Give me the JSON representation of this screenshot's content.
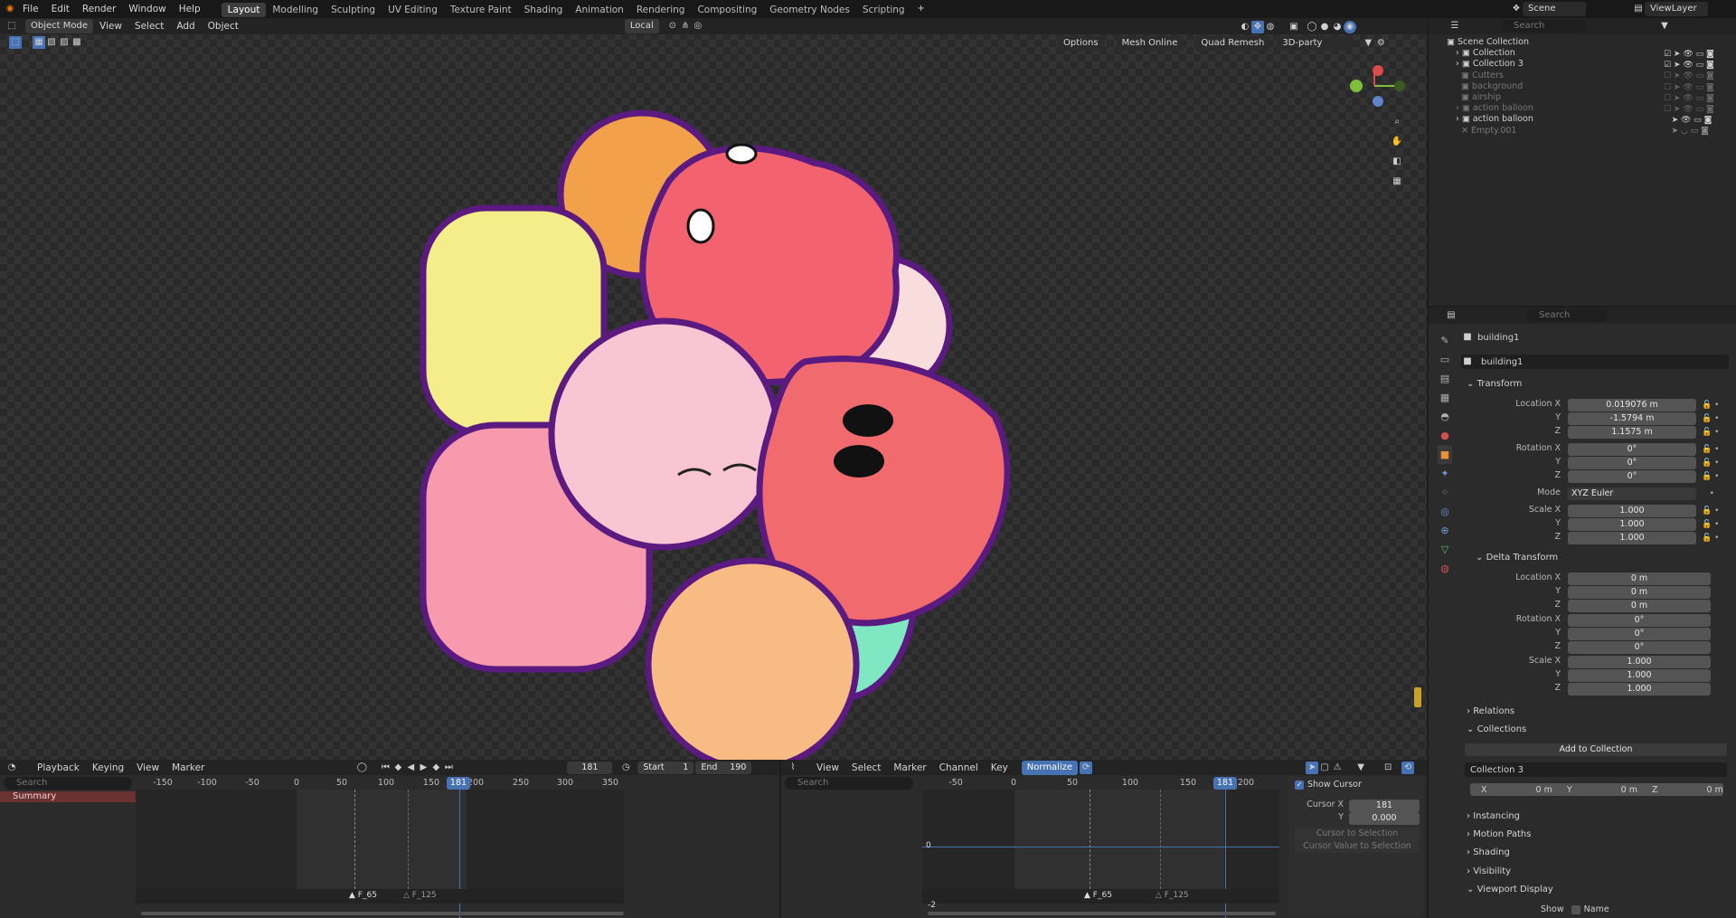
{
  "topbar": {
    "menus": [
      "File",
      "Edit",
      "Render",
      "Window",
      "Help"
    ],
    "workspaces": [
      "Layout",
      "Modelling",
      "Sculpting",
      "UV Editing",
      "Texture Paint",
      "Shading",
      "Animation",
      "Rendering",
      "Compositing",
      "Geometry Nodes",
      "Scripting"
    ],
    "scene_label": "Scene",
    "viewlayer_label": "ViewLayer"
  },
  "viewport": {
    "mode": "Object Mode",
    "menus": [
      "View",
      "Select",
      "Add",
      "Object"
    ],
    "orientation": "Local",
    "options": "Options",
    "overlays": [
      "Mesh Online",
      "Quad Remesh",
      "3D-party"
    ]
  },
  "outliner": {
    "search_placeholder": "Search",
    "root": "Scene Collection",
    "items": [
      {
        "label": "Collection",
        "dim": false
      },
      {
        "label": "Collection 3",
        "dim": false
      },
      {
        "label": "Cutters",
        "dim": true
      },
      {
        "label": "background",
        "dim": true
      },
      {
        "label": "airship",
        "dim": true
      },
      {
        "label": "action balloon",
        "dim": true
      },
      {
        "label": "action balloon",
        "dim": false
      },
      {
        "label": "Empty.001",
        "dim": true
      }
    ]
  },
  "properties": {
    "search_placeholder": "Search",
    "object_name": "building1",
    "data_name": "building1",
    "transform": {
      "title": "Transform",
      "location_label": "Location X",
      "location": [
        "0.019076 m",
        "-1.5794 m",
        "1.1575 m"
      ],
      "rotation_label": "Rotation X",
      "rotation": [
        "0°",
        "0°",
        "0°"
      ],
      "mode_label": "Mode",
      "mode": "XYZ Euler",
      "scale_label": "Scale X",
      "scale": [
        "1.000",
        "1.000",
        "1.000"
      ],
      "y": "Y",
      "z": "Z"
    },
    "delta": {
      "title": "Delta Transform",
      "location": [
        "0 m",
        "0 m",
        "0 m"
      ],
      "rotation": [
        "0°",
        "0°",
        "0°"
      ],
      "scale": [
        "1.000",
        "1.000",
        "1.000"
      ]
    },
    "relations": "Relations",
    "collections": "Collections",
    "add_to_collection": "Add to Collection",
    "collection_name": "Collection 3",
    "offset": {
      "x": "X",
      "y": "Y",
      "z": "Z",
      "xv": "0 m",
      "yv": "0 m",
      "zv": "0 m"
    },
    "instancing": "Instancing",
    "motion_paths": "Motion Paths",
    "shading": "Shading",
    "visibility": "Visibility",
    "viewport_display": "Viewport Display",
    "show_label": "Show",
    "name_label": "Name"
  },
  "timeline": {
    "menus": [
      "Playback",
      "Keying",
      "View",
      "Marker"
    ],
    "current_frame": "181",
    "start_label": "Start",
    "start": "1",
    "end_label": "End",
    "end": "190",
    "search_placeholder": "Search",
    "summary": "Summary",
    "ticks": [
      "-150",
      "-100",
      "-50",
      "0",
      "50",
      "100",
      "150",
      "200",
      "250",
      "300",
      "350"
    ],
    "frame_badge": "181",
    "markers": [
      "F_65",
      "F_125"
    ]
  },
  "graph": {
    "menus": [
      "View",
      "Select",
      "Marker",
      "Channel",
      "Key"
    ],
    "normalize": "Normalize",
    "search_placeholder": "Search",
    "ticks": [
      "-50",
      "0",
      "50",
      "100",
      "150",
      "200"
    ],
    "frame_badge": "181",
    "zero": "0",
    "bottom_value": "-2",
    "markers": [
      "F_65",
      "F_125"
    ],
    "show_cursor": "Show Cursor",
    "cursor_x_label": "Cursor X",
    "cursor_x": "181",
    "cursor_y_label": "Y",
    "cursor_y": "0.000",
    "cursor_to_selection": "Cursor to Selection",
    "cursor_value_to_selection": "Cursor Value to Selection"
  }
}
